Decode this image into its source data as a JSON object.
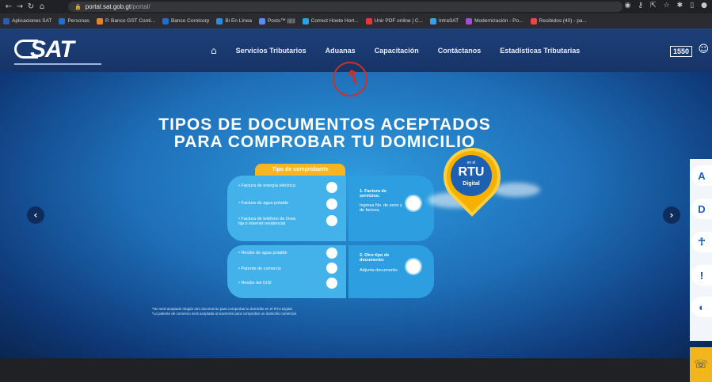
{
  "browser": {
    "url_host": "portal.sat.gob.gt",
    "url_path": "/portal/",
    "bookmarks": [
      {
        "label": "Aplicaciones SAT",
        "color": "#2a5db0"
      },
      {
        "label": "Personas",
        "color": "#1f6fd0"
      },
      {
        "label": "P. Banco GST Conti...",
        "color": "#e8812b"
      },
      {
        "label": "Banco Corolcorp",
        "color": "#1f6fd0"
      },
      {
        "label": "Bi En Línea",
        "color": "#2a8be0"
      },
      {
        "label": "Posts™ ||||||",
        "color": "#5a8df0"
      },
      {
        "label": "Correct Hoete Hort...",
        "color": "#2aa3e0"
      },
      {
        "label": "Unir PDF online | C...",
        "color": "#e33"
      },
      {
        "label": "IntraSAT",
        "color": "#39a0e6"
      },
      {
        "label": "Modernización - Po...",
        "color": "#a44fd0"
      },
      {
        "label": "Recibidos (40) - pa...",
        "color": "#e44"
      }
    ]
  },
  "header": {
    "logo_text": "SAT",
    "nav": [
      "Servicios Tributarios",
      "Aduanas",
      "Capacitación",
      "Contáctanos",
      "Estadísticas Tributarias"
    ],
    "phone": "1550"
  },
  "banner": {
    "headline_line1": "TIPOS DE DOCUMENTOS ACEPTADOS",
    "headline_line2": "PARA COMPROBAR TU DOMICILIO",
    "tab_label": "Tipo de comprobante",
    "group1_bullets": [
      "• Factura de energía eléctrica",
      "• Factura de agua potable",
      "• Factura de teléfono de línea fija o internet residencial"
    ],
    "group1_title": "1. Factura de servicios:",
    "group1_text": "Ingresa No. de serie y de factura.",
    "group2_bullets": [
      "• Recibo de agua potable",
      "• Patente de comercio",
      "• Recibo del IUSI"
    ],
    "group2_title": "2. Otro tipo de documento:",
    "group2_text": "Adjunta documento.",
    "rtu_small": "en el",
    "rtu_big": "RTU",
    "rtu_sub": "Digital",
    "footnote1": "*No será aceptado ningún otro documento para comprobar tu domicilio en el RTU Digital.",
    "footnote2": "*La patente de comercio será aceptada únicamente para comprobar un domicilio comercial."
  }
}
